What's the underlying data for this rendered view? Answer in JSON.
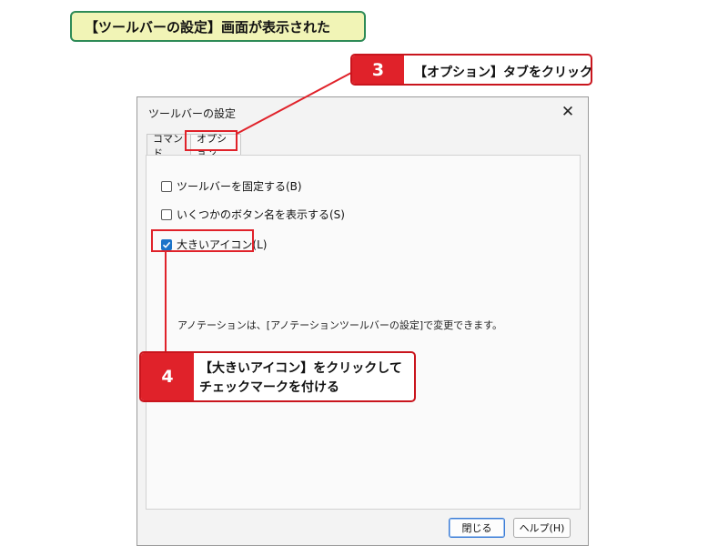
{
  "caption": "【ツールバーの設定】画面が表示された",
  "dialog": {
    "title": "ツールバーの設定",
    "close_icon": "close-icon",
    "tabs": [
      {
        "label": "コマンド",
        "selected": false
      },
      {
        "label": "オプション",
        "selected": true
      }
    ],
    "options": [
      {
        "label": "ツールバーを固定する(B)",
        "checked": false
      },
      {
        "label": "いくつかのボタン名を表示する(S)",
        "checked": false
      },
      {
        "label": "大きいアイコン(L)",
        "checked": true
      }
    ],
    "note": "アノテーションは、[アノテーションツールバーの設定]で変更できます。",
    "buttons": {
      "close": "閉じる",
      "help": "ヘルプ(H)"
    }
  },
  "callouts": {
    "step3": {
      "number": "3",
      "text": "【オプション】タブをクリック"
    },
    "step4": {
      "number": "4",
      "line1": "【大きいアイコン】をクリックして",
      "line2": "チェックマークを付ける"
    }
  },
  "colors": {
    "accent_red": "#e0222a",
    "caption_bg": "#f1f4b6",
    "caption_border": "#2e8b57",
    "checkbox_blue": "#1a73c9"
  }
}
